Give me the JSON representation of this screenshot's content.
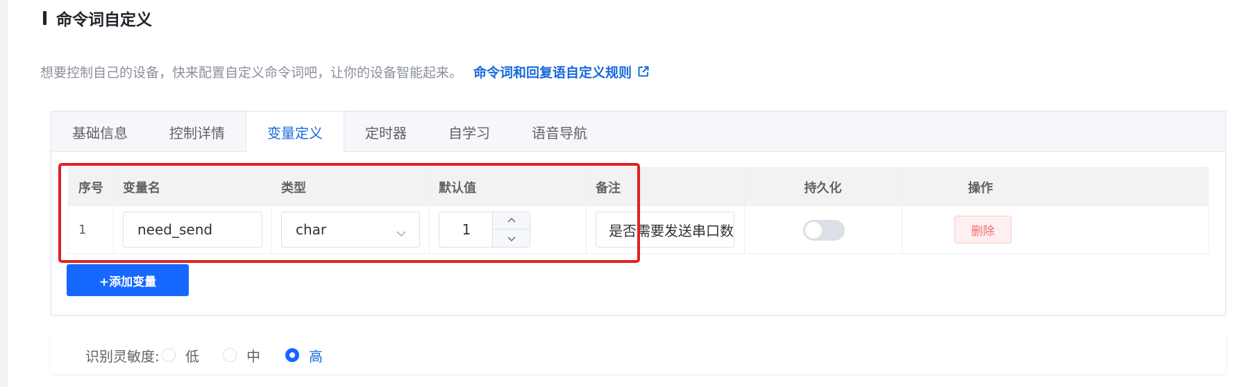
{
  "section": {
    "title": "命令词自定义"
  },
  "intro": {
    "text": "想要控制自己的设备，快来配置自定义命令词吧，让你的设备智能起来。",
    "link_text": "命令词和回复语自定义规则",
    "link_icon": "external-link-icon"
  },
  "tabs": [
    {
      "label": "基础信息",
      "active": false
    },
    {
      "label": "控制详情",
      "active": false
    },
    {
      "label": "变量定义",
      "active": true
    },
    {
      "label": "定时器",
      "active": false
    },
    {
      "label": "自学习",
      "active": false
    },
    {
      "label": "语音导航",
      "active": false
    }
  ],
  "table": {
    "columns": [
      "序号",
      "变量名",
      "类型",
      "默认值",
      "备注",
      "持久化",
      "操作"
    ],
    "rows": [
      {
        "index": "1",
        "var_name": "need_send",
        "type": "char",
        "default_value": "1",
        "remark": "是否需要发送串口数",
        "persist": false,
        "action": "删除"
      }
    ]
  },
  "add_button": "+添加变量",
  "sensitivity": {
    "label": "识别灵敏度:",
    "options": [
      "低",
      "中",
      "高"
    ],
    "selected": "高"
  },
  "colors": {
    "accent": "#1668ff",
    "link": "#1668dc",
    "danger": "#f56c6c",
    "highlight": "#e02020"
  }
}
